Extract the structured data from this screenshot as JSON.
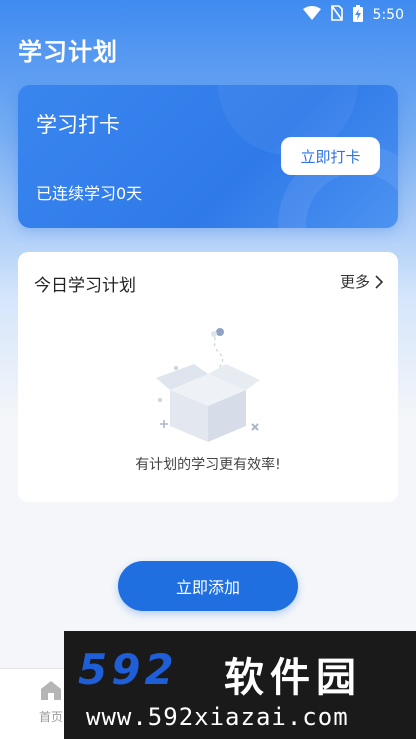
{
  "status_bar": {
    "time": "5:50"
  },
  "page": {
    "title": "学习计划"
  },
  "checkin": {
    "title": "学习打卡",
    "streak_text": "已连续学习0天",
    "button_label": "立即打卡"
  },
  "plan": {
    "title": "今日学习计划",
    "more_label": "更多",
    "empty_text": "有计划的学习更有效率!"
  },
  "actions": {
    "add_label": "立即添加"
  },
  "nav": {
    "home_label": "首页"
  },
  "watermark": {
    "logo": "592",
    "brand": "软件园",
    "url": "www.592xiazai.com"
  },
  "colors": {
    "primary": "#1f6fe0",
    "card_blue": "#3a86ee",
    "background": "#f4f6f9"
  }
}
